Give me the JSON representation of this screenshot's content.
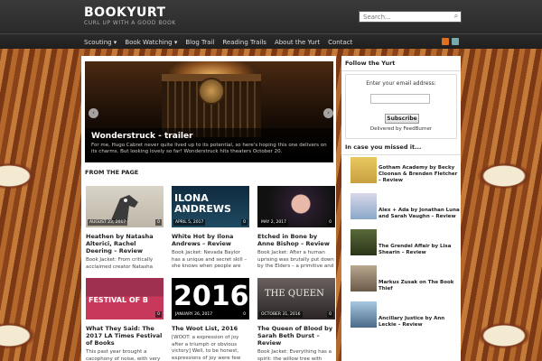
{
  "site": {
    "title": "BOOKYURT",
    "tagline": "CURL UP WITH A GOOD BOOK",
    "search_placeholder": "Search..."
  },
  "nav": {
    "items": [
      "Scouting ▾",
      "Book Watching ▾",
      "Blog Trail",
      "Reading Trails",
      "About the Yurt",
      "Contact"
    ]
  },
  "slider": {
    "title": "Wonderstruck - trailer",
    "text": "For me, Hugo Cabret never quite lived up to its potential, so here's hoping this one delivers on its charms. But looking lovely so far! Wonderstruck hits theaters October 20."
  },
  "section": {
    "title": "FROM THE PAGE"
  },
  "posts": [
    {
      "date": "AUGUST 23, 2017",
      "comments": "0",
      "title": "Heathen by Natasha Alterici, Rachel Deering – Review",
      "excerpt": "Book Jacket: From critically acclaimed creator Natasha"
    },
    {
      "date": "APRIL 5, 2017",
      "comments": "0",
      "title": "White Hot by Ilona Andrews – Review",
      "excerpt": "Book Jacket: Nevada Baylor has a unique and secret skill – she knows when people are"
    },
    {
      "date": "MAY 2, 2017",
      "comments": "0",
      "title": "Etched in Bone by Anne Bishop – Review",
      "excerpt": "Book Jacket: After a human uprising was brutally put down by the Elders – a primitive and"
    },
    {
      "date": "",
      "comments": "0",
      "title": "What They Said: The 2017 LA Times Festival of Books",
      "excerpt": "This past year brought a cacophony of noise, with very"
    },
    {
      "date": "JANUARY 26, 2017",
      "comments": "0",
      "title": "The Woot List, 2016",
      "excerpt": "[WOOT: a expression of joy after a triumph or obvious victory] Well, to be honest, expressions of joy were few"
    },
    {
      "date": "OCTOBER 31, 2016",
      "comments": "0",
      "title": "The Queen of Blood by Sarah Beth Durst – Review",
      "excerpt": "Book Jacket: Everything has a spirit: the willow tree with"
    }
  ],
  "post_thumb_text": {
    "ilona": "ILONA ANDREWS",
    "woot": "2016",
    "queen": "THE QUEEN",
    "festival": "FESTIVAL OF B"
  },
  "sidebar": {
    "follow_title": "Follow the Yurt",
    "follow_label": "Enter your email address:",
    "subscribe": "Subscribe",
    "delivered": "Delivered by FeedBurner",
    "missed_title": "In case you missed it...",
    "missed": [
      "Gotham Academy by Becky Cloonan & Brenden Fletcher – Review",
      "Alex + Ada by Jonathan Luna and Sarah Vaughn – Review",
      "The Grendel Affair by Lisa Shearin – Review",
      "Markus Zusak on The Book Thief",
      "Ancillary Justice by Ann Leckie – Review"
    ]
  }
}
